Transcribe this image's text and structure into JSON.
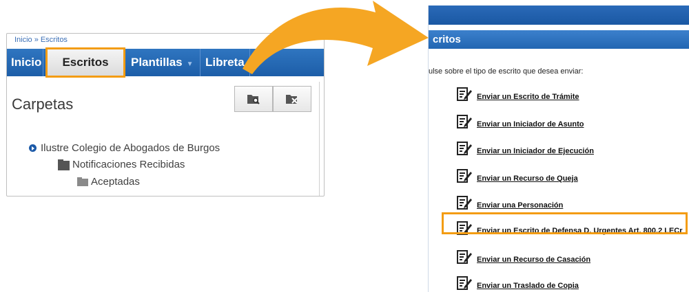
{
  "left": {
    "breadcrumb": {
      "home": "Inicio",
      "separator": "»",
      "current": "Escritos"
    },
    "nav": {
      "tabs": [
        {
          "label": "Inicio"
        },
        {
          "label": "Escritos",
          "selected": true
        },
        {
          "label": "Plantillas",
          "has_dropdown": true
        },
        {
          "label": "Libreta"
        }
      ]
    },
    "title": "Carpetas",
    "toolbar": [
      {
        "icon": "folder-search-icon"
      },
      {
        "icon": "folder-delete-icon"
      }
    ],
    "tree": [
      {
        "label": "Ilustre Colegio de Abogados de Burgos",
        "icon": "circle-arrow-icon"
      },
      {
        "label": "Notificaciones Recibidas",
        "icon": "folder-icon"
      },
      {
        "label": "Aceptadas",
        "icon": "folder-icon"
      }
    ]
  },
  "right": {
    "header": "critos",
    "instruction": "ulse sobre el tipo de escrito que desea enviar:",
    "options": [
      {
        "label": "Enviar un Escrito de Trámite"
      },
      {
        "label": "Enviar un Iniciador de Asunto"
      },
      {
        "label": "Enviar un Iniciador de Ejecución"
      },
      {
        "label": "Enviar un Recurso de Queja"
      },
      {
        "label": "Enviar una Personación"
      },
      {
        "label": "Enviar un Escrito de Defensa D. Urgentes Art. 800.2 LECr",
        "highlighted": true
      },
      {
        "label": "Enviar un Recurso de Casación"
      },
      {
        "label": "Enviar un Traslado de Copia"
      }
    ]
  },
  "colors": {
    "nav_blue": "#1d5ea8",
    "highlight_orange": "#f39c12",
    "arrow_orange": "#f5a623"
  }
}
